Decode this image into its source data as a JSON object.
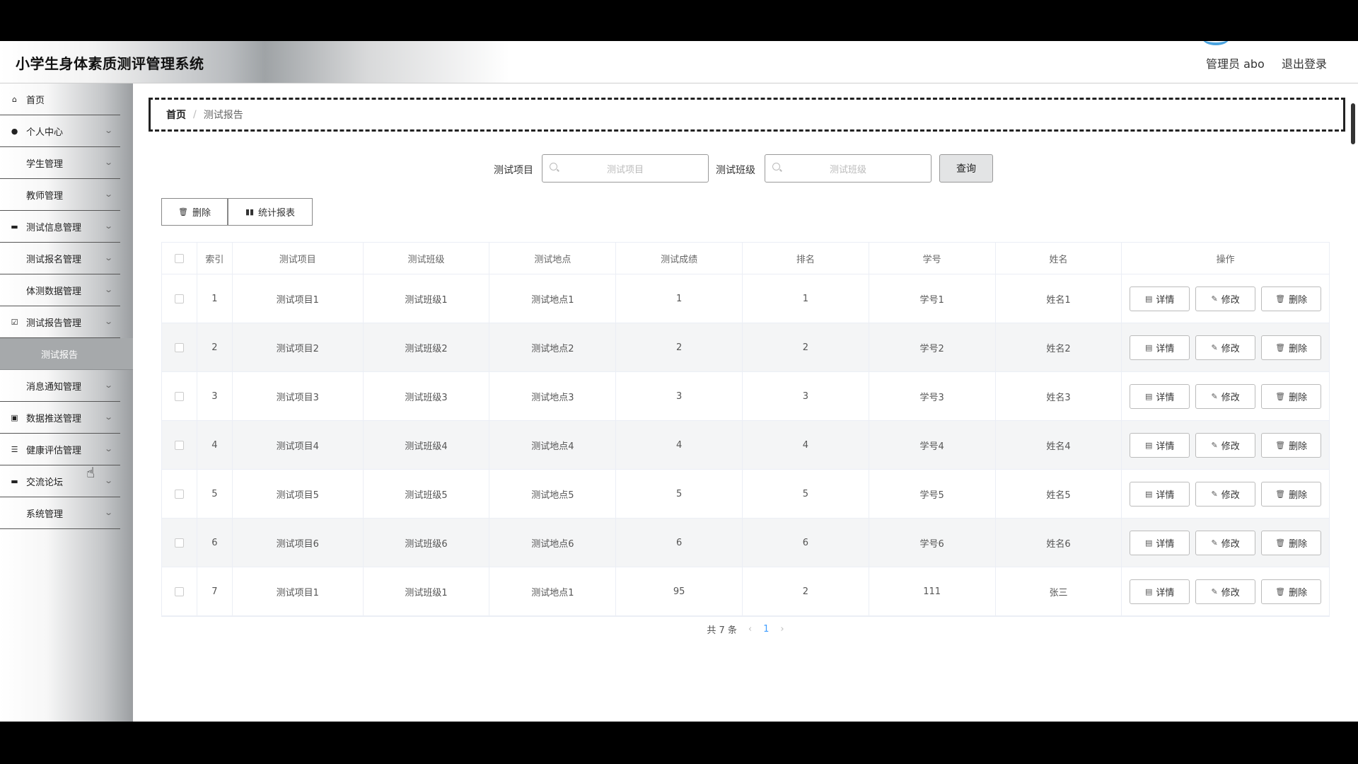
{
  "header": {
    "title": "小学生身体素质测评管理系统",
    "user_label": "管理员 abo",
    "logout": "退出登录"
  },
  "sidebar": {
    "items": [
      {
        "label": "首页",
        "icon": "home-icon",
        "expand": false
      },
      {
        "label": "个人中心",
        "icon": "user-icon",
        "expand": true
      },
      {
        "label": "学生管理",
        "icon": "grid-icon",
        "expand": true
      },
      {
        "label": "教师管理",
        "icon": "grid-icon",
        "expand": true
      },
      {
        "label": "测试信息管理",
        "icon": "monitor-icon",
        "expand": true
      },
      {
        "label": "测试报名管理",
        "icon": "grid-icon",
        "expand": true
      },
      {
        "label": "体测数据管理",
        "icon": "apps-icon",
        "expand": true
      },
      {
        "label": "测试报告管理",
        "icon": "checklist-icon",
        "expand": true
      }
    ],
    "active_sub": "测试报告",
    "items_after": [
      {
        "label": "消息通知管理",
        "icon": "grid-icon",
        "expand": true
      },
      {
        "label": "数据推送管理",
        "icon": "chart-box-icon",
        "expand": true
      },
      {
        "label": "健康评估管理",
        "icon": "sliders-icon",
        "expand": true
      },
      {
        "label": "交流论坛",
        "icon": "chat-icon",
        "expand": true
      },
      {
        "label": "系统管理",
        "icon": "grid-icon",
        "expand": true
      }
    ]
  },
  "breadcrumb": {
    "home": "首页",
    "separator": "/",
    "current": "测试报告"
  },
  "search": {
    "project_label": "测试项目",
    "project_placeholder": "测试项目",
    "class_label": "测试班级",
    "class_placeholder": "测试班级",
    "query_button": "查询"
  },
  "toolbar": {
    "delete_label": "删除",
    "stats_label": "统计报表"
  },
  "table": {
    "columns": [
      "索引",
      "测试项目",
      "测试班级",
      "测试地点",
      "测试成绩",
      "排名",
      "学号",
      "姓名",
      "操作"
    ],
    "rows": [
      [
        "1",
        "测试项目1",
        "测试班级1",
        "测试地点1",
        "1",
        "1",
        "学号1",
        "姓名1"
      ],
      [
        "2",
        "测试项目2",
        "测试班级2",
        "测试地点2",
        "2",
        "2",
        "学号2",
        "姓名2"
      ],
      [
        "3",
        "测试项目3",
        "测试班级3",
        "测试地点3",
        "3",
        "3",
        "学号3",
        "姓名3"
      ],
      [
        "4",
        "测试项目4",
        "测试班级4",
        "测试地点4",
        "4",
        "4",
        "学号4",
        "姓名4"
      ],
      [
        "5",
        "测试项目5",
        "测试班级5",
        "测试地点5",
        "5",
        "5",
        "学号5",
        "姓名5"
      ],
      [
        "6",
        "测试项目6",
        "测试班级6",
        "测试地点6",
        "6",
        "6",
        "学号6",
        "姓名6"
      ],
      [
        "7",
        "测试项目1",
        "测试班级1",
        "测试地点1",
        "95",
        "2",
        "111",
        "张三"
      ]
    ],
    "actions": {
      "detail": "详情",
      "edit": "修改",
      "delete": "删除"
    }
  },
  "pagination": {
    "total_text": "共 7 条",
    "current_page": "1",
    "prev": "‹",
    "next": "›"
  }
}
